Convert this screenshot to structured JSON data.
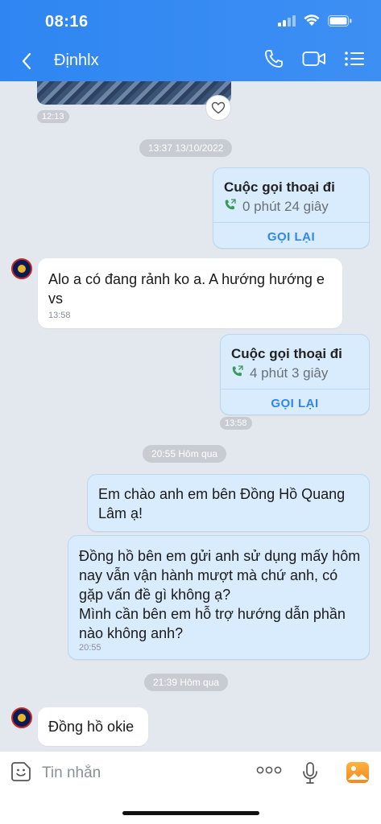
{
  "status_bar": {
    "time": "08:16"
  },
  "header": {
    "contact_name": "Địnhlx"
  },
  "messages": {
    "img_time": "12:13",
    "divider1": "13:37 13/10/2022",
    "call1": {
      "title": "Cuộc gọi thoại đi",
      "duration": "0 phút 24 giây",
      "callback": "GỌI LẠI"
    },
    "msg1": {
      "text": "Alo a có đang rảnh ko a. A hướng hướng e vs",
      "time": "13:58"
    },
    "call2": {
      "title": "Cuộc gọi thoại đi",
      "duration": "4 phút 3 giây",
      "callback": "GỌI LẠI",
      "time": "13:58"
    },
    "divider2": "20:55 Hôm qua",
    "msg2": {
      "text": "Em chào anh  em bên Đồng Hồ Quang Lâm ạ!"
    },
    "msg3": {
      "text": "Đồng hồ bên em gửi anh sử dụng mấy hôm nay vẫn vận hành mượt mà chứ anh, có gặp vấn đề gì không ạ?\nMình cần bên em hỗ trợ hướng dẫn phần nào không anh?",
      "time": "20:55"
    },
    "divider3": "21:39 Hôm qua",
    "msg4": {
      "text": "Đồng hồ okie"
    }
  },
  "input": {
    "placeholder": "Tin nhắn",
    "more": "ooo"
  },
  "colors": {
    "accent": "#2f86f2",
    "outgoing_bg": "#d9ecfd",
    "chat_bg": "#e3e8ee"
  }
}
